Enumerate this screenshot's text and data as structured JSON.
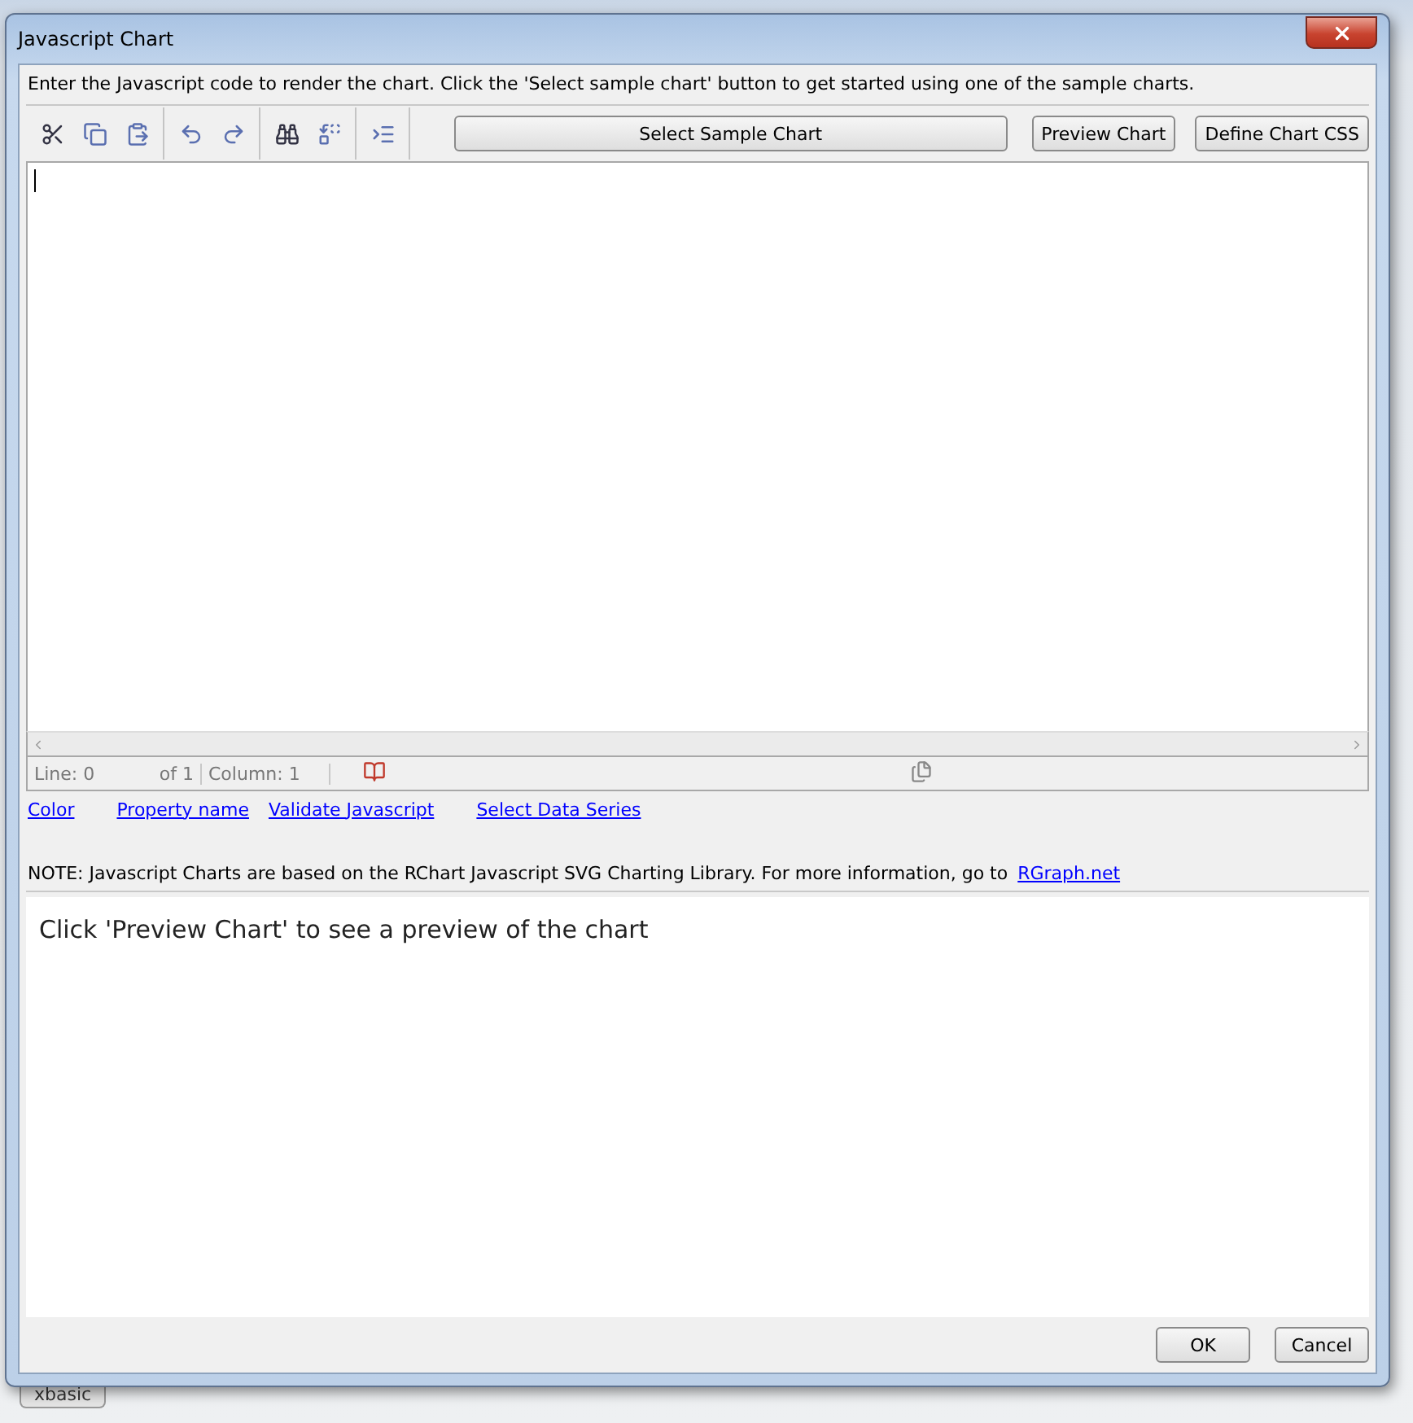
{
  "window": {
    "title": "Javascript Chart"
  },
  "intro": "Enter the Javascript code to render the chart. Click the 'Select sample chart' button to get started using one of the sample charts.",
  "toolbar": {
    "select_button": "Select Sample Chart",
    "buttons": [
      "Preview Chart",
      "Define Chart CSS"
    ]
  },
  "status_bar": {
    "line": "Line: 0",
    "of": "of 1",
    "column": "Column: 1"
  },
  "links": [
    "Color",
    "Property name",
    "Validate Javascript",
    "Select Data Series"
  ],
  "note": {
    "text": "NOTE: Javascript Charts are based on the RChart Javascript SVG Charting Library. For more information, go to",
    "link": "RGraph.net"
  },
  "preview": {
    "message": "Click 'Preview Chart' to see a preview of the chart"
  },
  "footer_buttons": [
    "OK",
    "Cancel"
  ],
  "background_tab": "xbasic"
}
